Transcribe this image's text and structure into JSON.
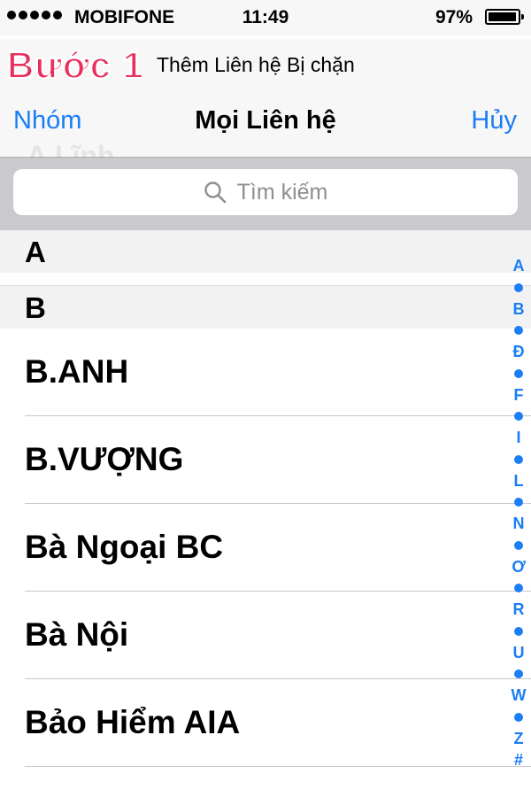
{
  "status_bar": {
    "carrier": "MOBIFONE",
    "time": "11:49",
    "battery": "97%",
    "battery_level": 0.97
  },
  "caption": {
    "step": "Bước 1",
    "description": "Thêm Liên hệ Bị chặn"
  },
  "nav": {
    "left": "Nhóm",
    "title": "Mọi Liên hệ",
    "right": "Hủy",
    "ghost": "A.Lĩnh"
  },
  "search": {
    "placeholder": "Tìm kiếm"
  },
  "sections": [
    {
      "header": "A",
      "contacts": []
    },
    {
      "header": "B",
      "contacts": [
        "B.ANH",
        "B.VƯỢNG",
        "Bà Ngoại BC",
        "Bà Nội",
        "Bảo Hiểm AIA"
      ]
    }
  ],
  "index": [
    "A",
    "B",
    "Đ",
    "F",
    "I",
    "L",
    "N",
    "Ơ",
    "R",
    "U",
    "W",
    "Z",
    "#"
  ],
  "colors": {
    "accent": "#1a7ef5",
    "step_label": "#e8305d"
  }
}
